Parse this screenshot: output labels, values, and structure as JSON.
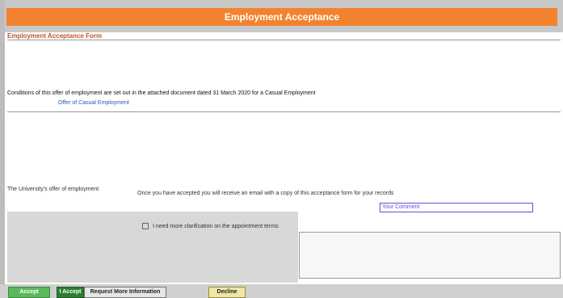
{
  "header": {
    "title": "Employment Acceptance"
  },
  "form": {
    "title": "Employment Acceptance Form",
    "conditions_line": "Conditions of this offer of employment are set out in the attached document dated 31 March 2020 for a Casual Employment",
    "employment_link": "Offer of Casual Employment",
    "after_accept_note": "Once you have accepted you will receive an email with a copy of this acceptance form for your records",
    "university_line": "The University's offer of employment",
    "comment_label": "Your Comment",
    "clarification_label": "I need more clarification on the appointment terms"
  },
  "buttons": {
    "accept": "Accept",
    "request_info": "Request More Information",
    "accept2": "I Accept",
    "decline": "Decline"
  }
}
